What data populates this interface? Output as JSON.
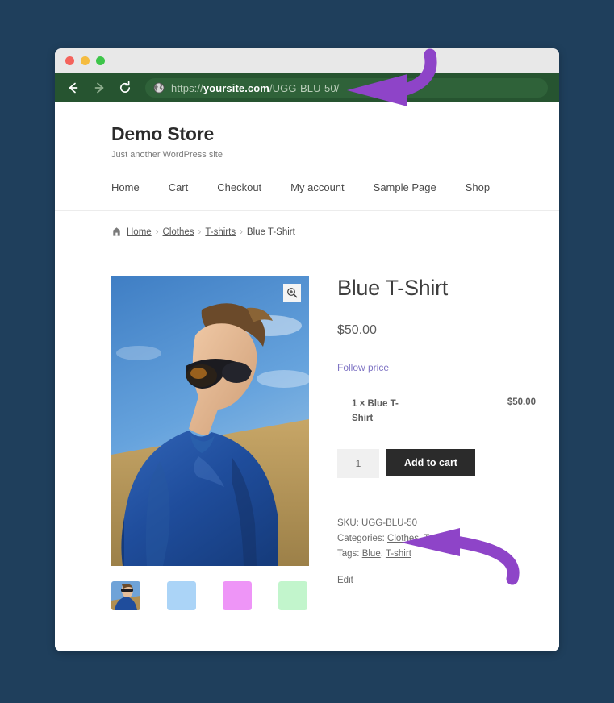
{
  "colors": {
    "desktop_background": "#1f3f5c",
    "browser_toolbar": "#265430",
    "url_pill": "#2f6239",
    "accent_link": "#7f74c4",
    "add_to_cart_button": "#2b2b2b",
    "annotation_arrow": "#8e44c8",
    "thumb_blue": "#abd4f7",
    "thumb_pink": "#ee95f7",
    "thumb_green": "#c2f5cc"
  },
  "browser": {
    "traffic_lights": [
      "close-red",
      "minimize-yellow",
      "maximize-green"
    ],
    "back_icon": "arrow-left-icon",
    "forward_icon": "arrow-right-icon",
    "reload_icon": "reload-icon",
    "site_icon": "globe-icon",
    "url": {
      "scheme": "https://",
      "host": "yoursite.com",
      "path": "/UGG-BLU-50/"
    }
  },
  "site": {
    "title": "Demo Store",
    "tagline": "Just another WordPress site"
  },
  "nav": {
    "items": [
      {
        "label": "Home"
      },
      {
        "label": "Cart"
      },
      {
        "label": "Checkout"
      },
      {
        "label": "My account"
      },
      {
        "label": "Sample Page"
      },
      {
        "label": "Shop"
      }
    ]
  },
  "breadcrumb": {
    "home_icon": "house-icon",
    "items": [
      {
        "label": "Home",
        "link": true
      },
      {
        "label": "Clothes",
        "link": true
      },
      {
        "label": "T-shirts",
        "link": true
      },
      {
        "label": "Blue T-Shirt",
        "link": false
      }
    ],
    "separator": "›"
  },
  "gallery": {
    "zoom_icon": "magnifier-plus-icon",
    "main_image_alt": "Young person in blue t-shirt and sunglasses outdoors",
    "thumbnails": [
      {
        "name": "thumb-photo",
        "type": "photo"
      },
      {
        "name": "thumb-blue",
        "type": "swatch",
        "color": "#abd4f7"
      },
      {
        "name": "thumb-pink",
        "type": "swatch",
        "color": "#ee95f7"
      },
      {
        "name": "thumb-green",
        "type": "swatch",
        "color": "#c2f5cc"
      }
    ]
  },
  "product": {
    "title": "Blue T-Shirt",
    "price": "$50.00",
    "follow_price_label": "Follow price",
    "bundle": {
      "name": "1 × Blue T-Shirt",
      "price": "$50.00"
    },
    "quantity": "1",
    "add_to_cart_label": "Add to cart",
    "meta": {
      "sku_label": "SKU:",
      "sku_value": "UGG-BLU-50",
      "categories_label": "Categories:",
      "categories": [
        "Clothes",
        "T-shirts"
      ],
      "tags_label": "Tags:",
      "tags": [
        "Blue",
        "T-shirt"
      ],
      "edit_label": "Edit"
    }
  },
  "annotations": [
    {
      "name": "arrow-to-url",
      "points_at": "address-bar-url"
    },
    {
      "name": "arrow-to-sku",
      "points_at": "product-sku"
    }
  ]
}
